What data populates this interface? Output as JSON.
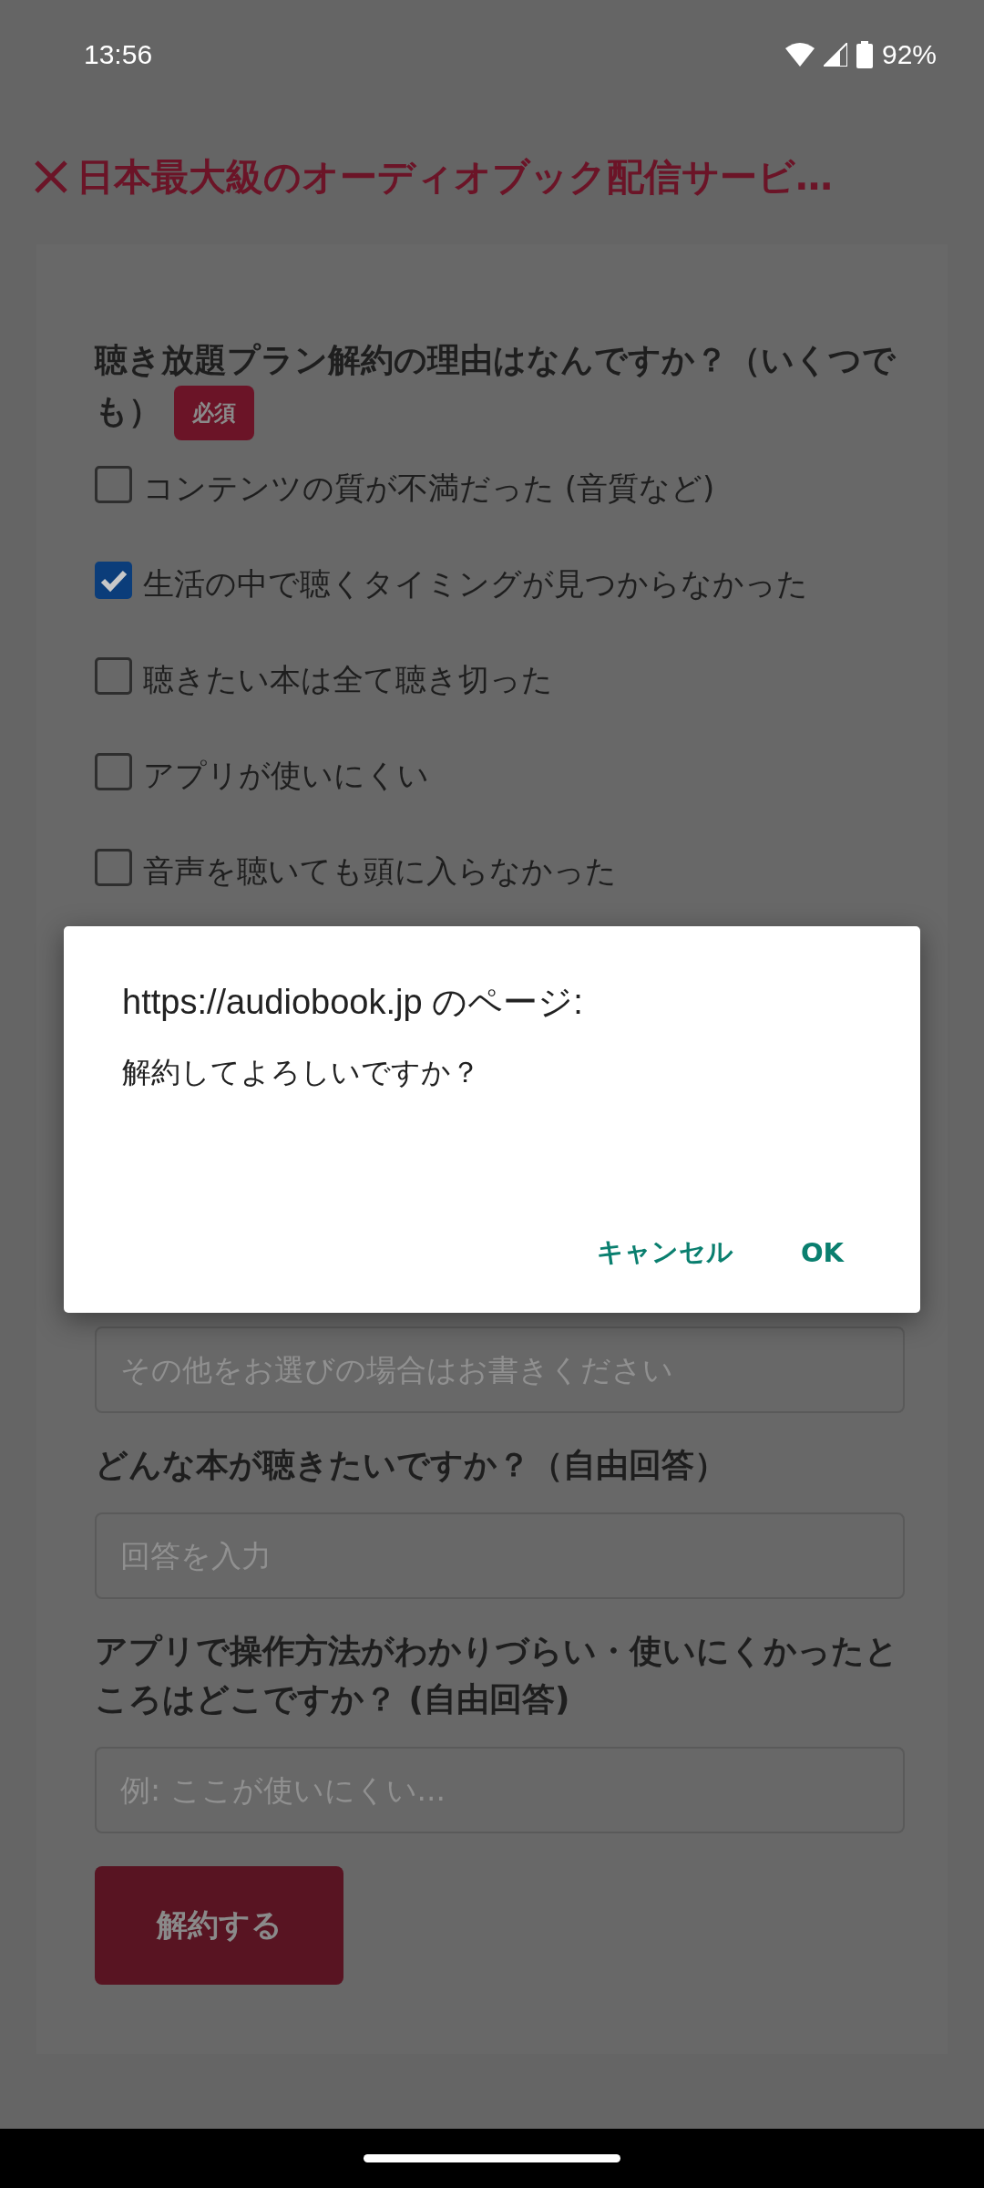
{
  "status_bar": {
    "time": "13:56",
    "battery": "92%"
  },
  "header": {
    "title": "日本最大級のオーディオブック配信サービ…"
  },
  "form": {
    "question": {
      "text": "聴き放題プラン解約の理由はなんですか？（いくつでも）",
      "badge": "必須"
    },
    "options": [
      {
        "label": "コンテンツの質が不満だった (音質など)",
        "checked": false
      },
      {
        "label": "生活の中で聴くタイミングが見つからなかった",
        "checked": true
      },
      {
        "label": "聴きたい本は全て聴き切った",
        "checked": false
      },
      {
        "label": "アプリが使いにくい",
        "checked": false
      },
      {
        "label": "音声を聴いても頭に入らなかった",
        "checked": false
      }
    ],
    "other_field": {
      "placeholder": "その他をお選びの場合はお書きください"
    },
    "questions": [
      {
        "label": "どんな本が聴きたいですか？（自由回答）",
        "placeholder": "回答を入力"
      },
      {
        "label": "アプリで操作方法がわかりづらい・使いにくかったところはどこですか？ (自由回答)",
        "placeholder": "例: ここが使いにくい..."
      }
    ],
    "submit_button": "解約する"
  },
  "dialog": {
    "title": "https://audiobook.jp のページ:",
    "message": "解約してよろしいですか？",
    "buttons": [
      "キャンセル",
      "OK"
    ]
  }
}
